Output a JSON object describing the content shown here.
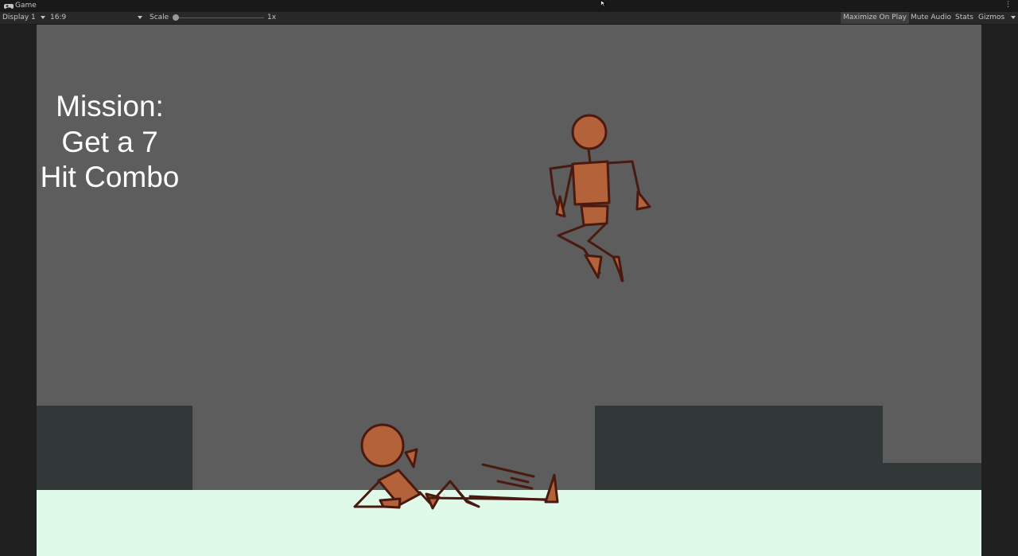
{
  "window": {
    "tab_title": "Game",
    "tab_icon": "gamepad-icon",
    "menu_icon": "kebab-menu-icon"
  },
  "toolbar": {
    "display": "Display 1",
    "aspect": "16:9",
    "scale_label": "Scale",
    "scale_value": "1x",
    "scale_level": 1,
    "maximize": "Maximize On Play",
    "mute": "Mute Audio",
    "stats": "Stats",
    "gizmos": "Gizmos"
  },
  "game": {
    "mission_text": "Mission:\nGet a 7\nHit Combo",
    "colors": {
      "background": "#5d5d5d",
      "platform": "#313837",
      "ground": "#e0faea",
      "fighter_fill": "#b4623a",
      "fighter_outline": "#4a1a10",
      "mission_text": "#ffffff"
    }
  }
}
